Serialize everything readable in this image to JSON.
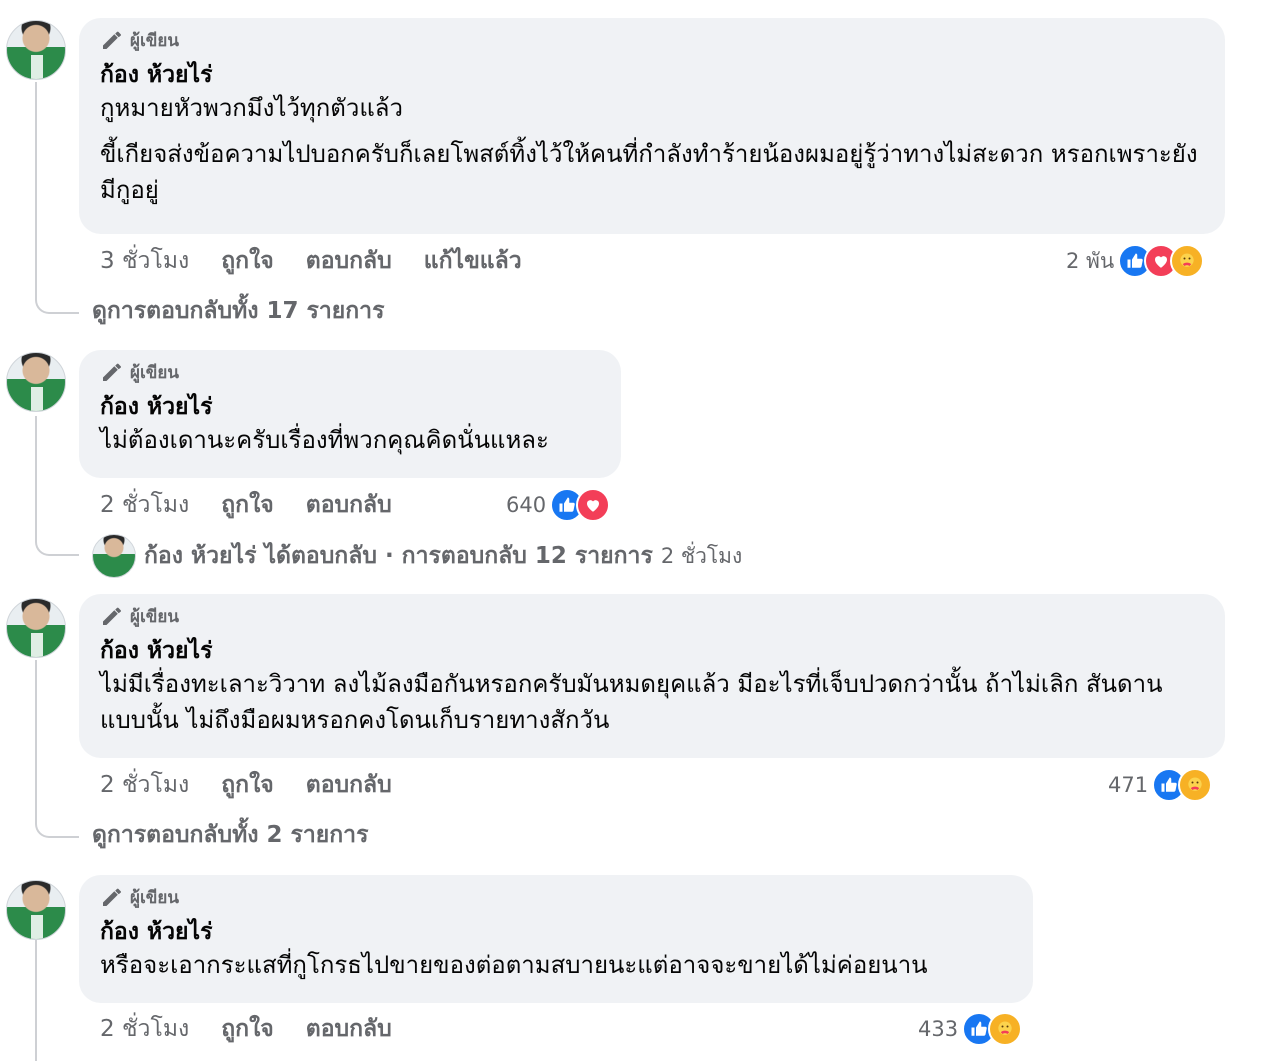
{
  "author_badge": "ผู้เขียน",
  "actions": {
    "like": "ถูกใจ",
    "reply": "ตอบกลับ",
    "edited": "แก้ไขแล้ว"
  },
  "colors": {
    "bubble": "#f0f2f5",
    "meta": "#65676b",
    "like": "#1877f2",
    "love": "#f33e58",
    "care": "#f7b125"
  },
  "comments": [
    {
      "name": "ก้อง ห้วยไร่",
      "lines": [
        "กูหมายหัวพวกมึงไว้ทุกตัวแล้ว",
        "ขี้เกียจส่งข้อความไปบอกครับก็เลยโพสต์ทิ้งไว้ให้คนที่กำลังทำร้ายน้องผมอยู่รู้ว่าทางไม่สะดวก หรอกเพราะยังมีกูอยู่"
      ],
      "time": "3 ชั่วโมง",
      "reaction_count": "2 พัน",
      "reaction_icons": [
        "like-icon",
        "love-icon",
        "care-icon"
      ],
      "view_replies": "ดูการตอบกลับทั้ง 17 รายการ"
    },
    {
      "name": "ก้อง ห้วยไร่",
      "lines": [
        "ไม่ต้องเดานะครับเรื่องที่พวกคุณคิดนั่นแหละ"
      ],
      "time": "2 ชั่วโมง",
      "reaction_count": "640",
      "reaction_icons": [
        "like-icon",
        "love-icon"
      ],
      "reply_summary": {
        "text": "ก้อง ห้วยไร่ ได้ตอบกลับ · การตอบกลับ 12 รายการ",
        "time": "2 ชั่วโมง"
      }
    },
    {
      "name": "ก้อง ห้วยไร่",
      "lines": [
        "ไม่มีเรื่องทะเลาะวิวาท ลงไม้ลงมือกันหรอกครับมันหมดยุคแล้ว มีอะไรที่เจ็บปวดกว่านั้น ถ้าไม่เลิก สันดานแบบนั้น ไม่ถึงมือผมหรอกคงโดนเก็บรายทางสักวัน"
      ],
      "time": "2 ชั่วโมง",
      "reaction_count": "471",
      "reaction_icons": [
        "like-icon",
        "care-icon"
      ],
      "view_replies": "ดูการตอบกลับทั้ง 2 รายการ"
    },
    {
      "name": "ก้อง ห้วยไร่",
      "lines": [
        "หรือจะเอากระแสที่กูโกรธไปขายของต่อตามสบายนะแต่อาจจะขายได้ไม่ค่อยนาน"
      ],
      "time": "2 ชั่วโมง",
      "reaction_count": "433",
      "reaction_icons": [
        "like-icon",
        "care-icon"
      ]
    }
  ]
}
